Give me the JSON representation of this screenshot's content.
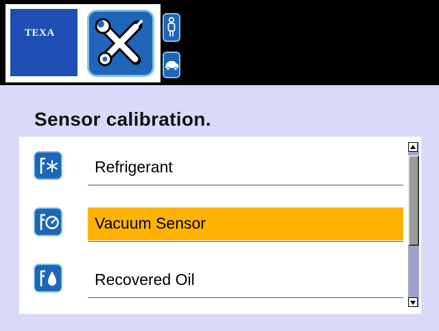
{
  "header": {
    "logo_text": "TEXA",
    "tools_icon": "wrench-screwdriver-icon",
    "person_icon": "person-icon",
    "car_icon": "car-icon"
  },
  "title": "Sensor calibration.",
  "list": {
    "items": [
      {
        "label": "Refrigerant",
        "icon": "gauge-snowflake-icon",
        "selected": false
      },
      {
        "label": "Vacuum Sensor",
        "icon": "gauge-vacuum-icon",
        "selected": true
      },
      {
        "label": "Recovered Oil",
        "icon": "gauge-oil-drop-icon",
        "selected": false
      }
    ],
    "scroll_position": 0.0
  },
  "colors": {
    "header_bg": "#000000",
    "logo_blue": "#1f4fb4",
    "tile_blue": "#1f66b8",
    "tile_border": "#7fc3ea",
    "page_bg": "#d9d9f9",
    "selection": "#ffb300"
  }
}
